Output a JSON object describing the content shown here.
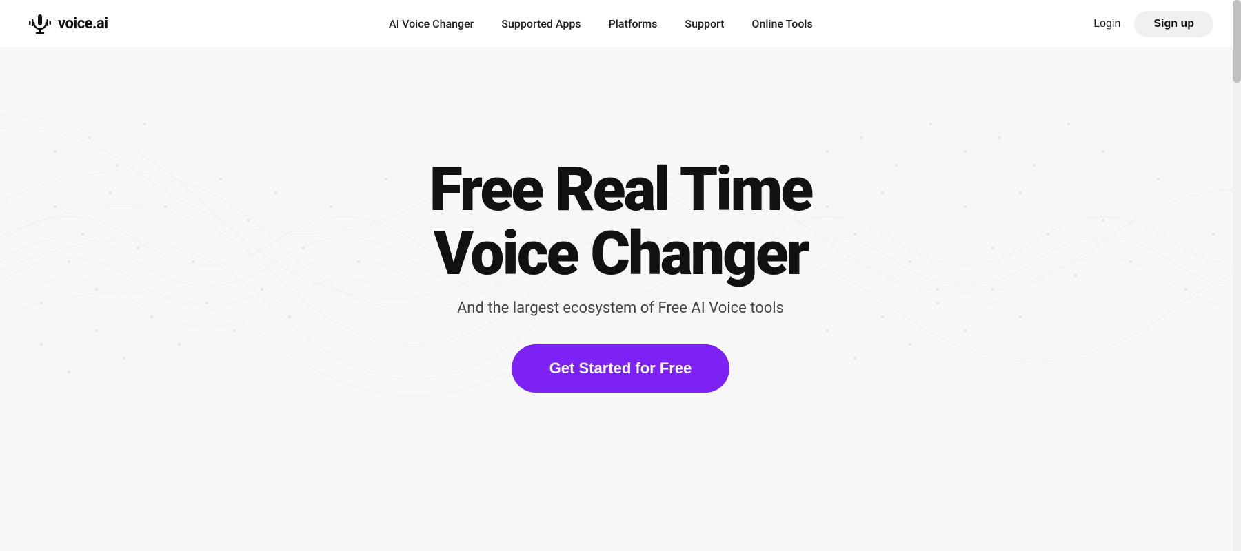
{
  "brand": {
    "logo_text": "voice.ai",
    "logo_icon": "🎙"
  },
  "navbar": {
    "links": [
      {
        "label": "AI Voice Changer",
        "id": "ai-voice-changer"
      },
      {
        "label": "Supported Apps",
        "id": "supported-apps"
      },
      {
        "label": "Platforms",
        "id": "platforms"
      },
      {
        "label": "Support",
        "id": "support"
      },
      {
        "label": "Online Tools",
        "id": "online-tools"
      }
    ],
    "login_label": "Login",
    "signup_label": "Sign up"
  },
  "hero": {
    "title_line1": "Free Real Time",
    "title_line2": "Voice Changer",
    "subtitle": "And the largest ecosystem of Free AI Voice tools",
    "cta_label": "Get Started for Free"
  },
  "colors": {
    "cta_bg": "#7c22f5",
    "cta_text": "#ffffff",
    "nav_text": "#222222",
    "signup_bg": "#eeeeee"
  }
}
